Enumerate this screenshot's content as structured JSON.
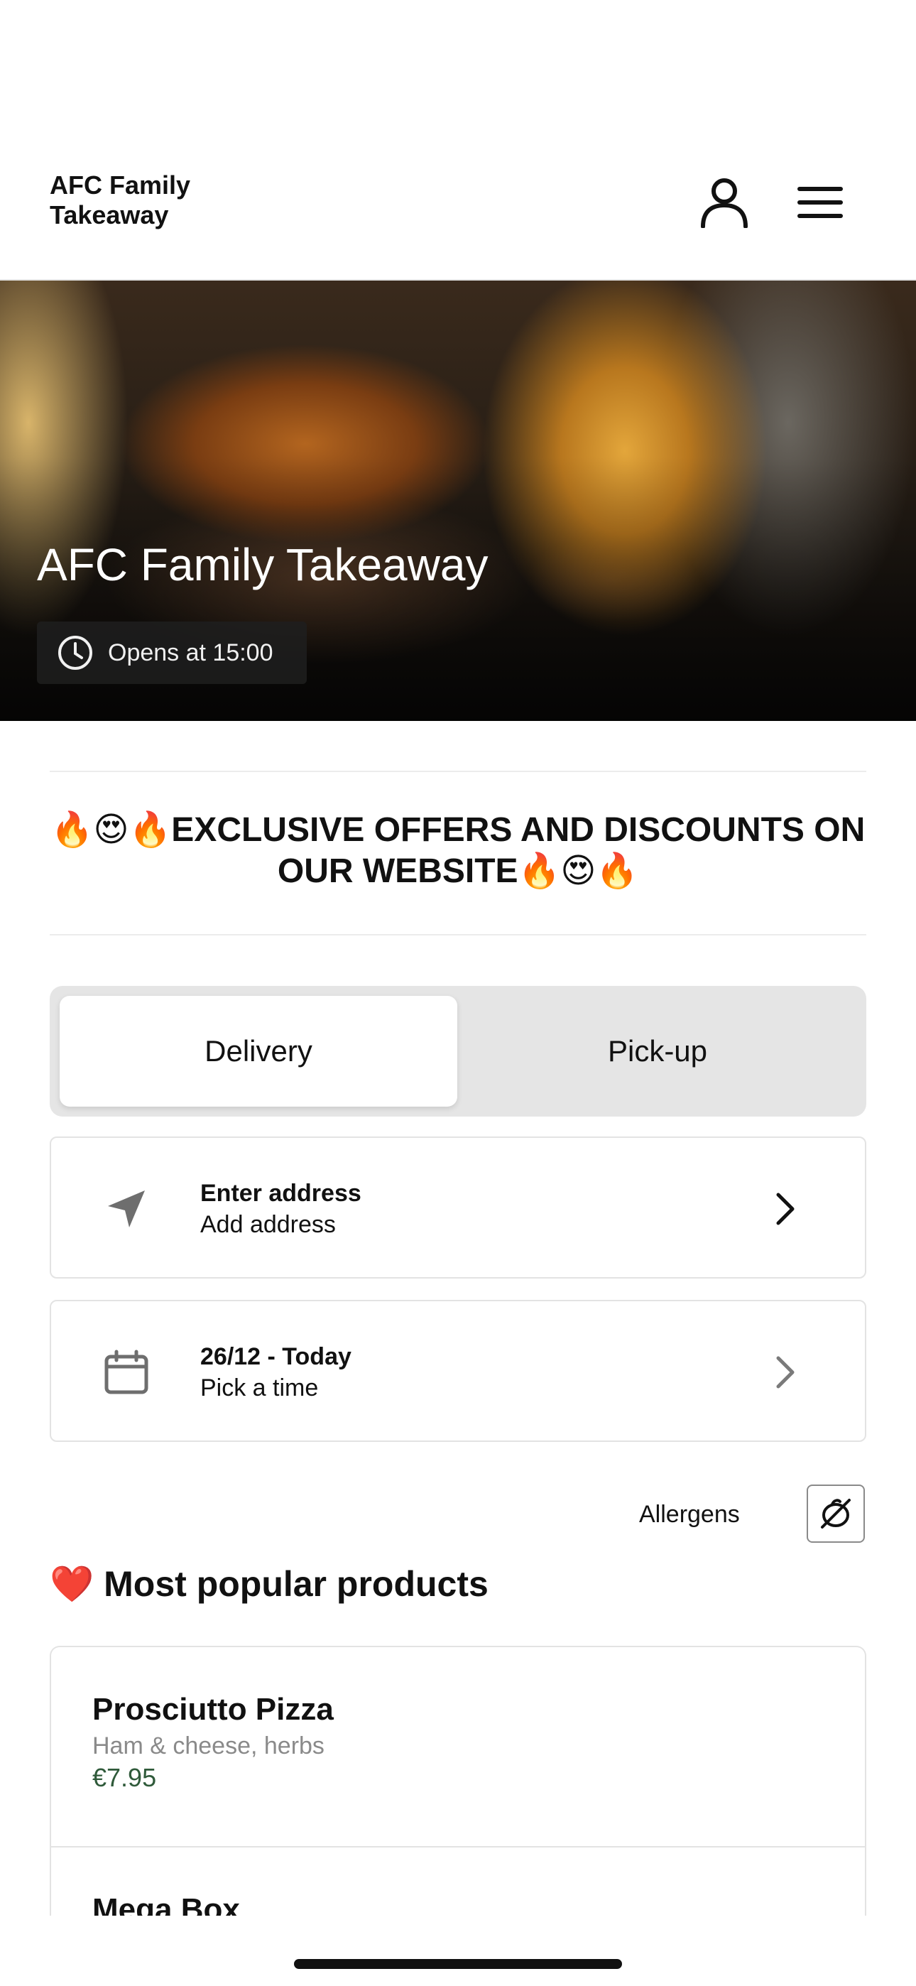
{
  "header": {
    "brand": "AFC Family Takeaway",
    "account_icon": "user-icon",
    "menu_icon": "hamburger-menu-icon"
  },
  "hero": {
    "title": "AFC Family Takeaway",
    "hours_icon": "clock-icon",
    "hours_text": "Opens at 15:00"
  },
  "promo": {
    "text": "🔥😍🔥EXCLUSIVE OFFERS AND DISCOUNTS ON OUR WEBSITE🔥😍🔥"
  },
  "order_mode": {
    "options": [
      "Delivery",
      "Pick-up"
    ],
    "selected": "Delivery"
  },
  "address": {
    "icon": "location-arrow-icon",
    "title": "Enter address",
    "subtitle": "Add address"
  },
  "time": {
    "icon": "calendar-icon",
    "title": "26/12 - Today",
    "subtitle": "Pick a time"
  },
  "allergens": {
    "label": "Allergens",
    "icon": "allergen-icon"
  },
  "popular": {
    "title": "❤️ Most popular products",
    "products": [
      {
        "name": "Prosciutto Pizza",
        "description": "Ham & cheese, herbs",
        "price": "€7.95"
      },
      {
        "name": "Mega Box",
        "description": "",
        "price": ""
      }
    ]
  },
  "colors": {
    "price": "#2f5a3a",
    "toggle_bg": "#e5e5e5",
    "border": "#e3e3e3"
  }
}
